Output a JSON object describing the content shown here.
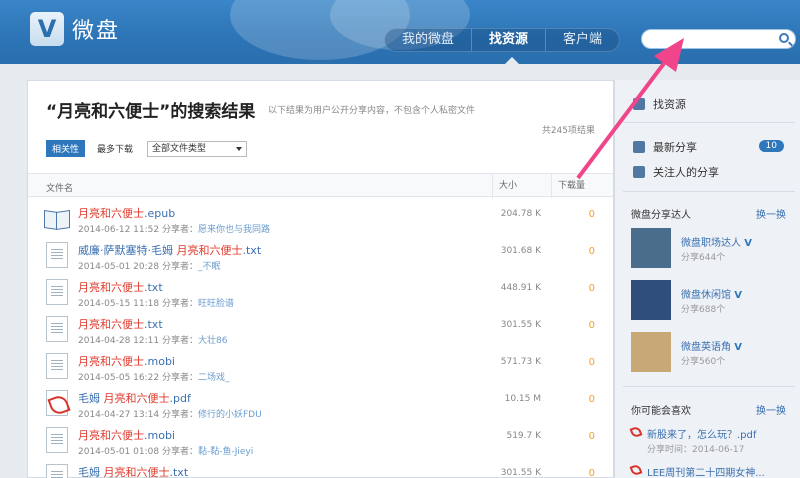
{
  "header": {
    "logo_letter": "V",
    "logo_text": "微盘",
    "nav": [
      "我的微盘",
      "找资源",
      "客户端"
    ],
    "search_value": ""
  },
  "main": {
    "title": "“月亮和六便士”的搜索结果",
    "subtitle": "以下结果为用户公开分享内容，不包含个人私密文件",
    "count": "共245项结果",
    "sort_active": "相关性",
    "sort_other": "最多下载",
    "filetype": "全部文件类型",
    "col_name": "文件名",
    "col_size": "大小",
    "col_dl": "下载量",
    "files": [
      {
        "type": "epub",
        "prefix": "",
        "hl": "月亮和六便士",
        "suffix": ".epub",
        "date": "2014-06-12 11:52",
        "sharer_label": "分享者：",
        "sharer": "愿来你也与我同路",
        "size": "204.78 K",
        "downloads": "0"
      },
      {
        "type": "txt",
        "prefix": "威廉·萨默塞特·毛姆 ",
        "hl": "月亮和六便士",
        "suffix": ".txt",
        "date": "2014-05-01 20:28",
        "sharer_label": "分享者：",
        "sharer": "_不眠",
        "size": "301.68 K",
        "downloads": "0"
      },
      {
        "type": "txt",
        "prefix": "",
        "hl": "月亮和六便士",
        "suffix": ".txt",
        "date": "2014-05-15 11:18",
        "sharer_label": "分享者：",
        "sharer": "旺旺脸谱",
        "size": "448.91 K",
        "downloads": "0"
      },
      {
        "type": "txt",
        "prefix": "",
        "hl": "月亮和六便士",
        "suffix": ".txt",
        "date": "2014-04-28 12:11",
        "sharer_label": "分享者：",
        "sharer": "大壮86",
        "size": "301.55 K",
        "downloads": "0"
      },
      {
        "type": "txt",
        "prefix": "",
        "hl": "月亮和六便士",
        "suffix": ".mobi",
        "date": "2014-05-05 16:22",
        "sharer_label": "分享者：",
        "sharer": "二场戏_",
        "size": "571.73 K",
        "downloads": "0"
      },
      {
        "type": "pdf",
        "prefix": "毛姆 ",
        "hl": "月亮和六便士",
        "suffix": ".pdf",
        "date": "2014-04-27 13:14",
        "sharer_label": "分享者：",
        "sharer": "修行的小妖FDU",
        "size": "10.15 M",
        "downloads": "0"
      },
      {
        "type": "txt",
        "prefix": "",
        "hl": "月亮和六便士",
        "suffix": ".mobi",
        "date": "2014-05-01 01:08",
        "sharer_label": "分享者：",
        "sharer": "黏-黏-鱼-Jieyi",
        "size": "519.7 K",
        "downloads": "0"
      },
      {
        "type": "txt",
        "prefix": "毛姆 ",
        "hl": "月亮和六便士",
        "suffix": ".txt",
        "date": "",
        "sharer_label": "",
        "sharer": "",
        "size": "301.55 K",
        "downloads": "0"
      }
    ]
  },
  "sidebar": {
    "find": "找资源",
    "latest": "最新分享",
    "latest_badge": "10",
    "following": "关注人的分享",
    "talent_title": "微盘分享达人",
    "swap": "换一换",
    "talents": [
      {
        "name": "微盘职场达人",
        "verified": "V",
        "count": "分享644个",
        "color": "#4a6d8c"
      },
      {
        "name": "微盘休闲馆",
        "verified": "V",
        "count": "分享688个",
        "color": "#2f4f7a"
      },
      {
        "name": "微盘英语角",
        "verified": "V",
        "count": "分享560个",
        "color": "#c9a878"
      }
    ],
    "like_title": "你可能会喜欢",
    "likes": [
      {
        "title": "新股来了，怎么玩？.pdf",
        "time": "分享时间：2014-06-17"
      },
      {
        "title": "LEE周刊第二十四期女神...",
        "time": ""
      }
    ]
  },
  "colors": {
    "accent": "#2f77bd",
    "highlight": "#e03a2c",
    "arrow": "#f0458a"
  }
}
